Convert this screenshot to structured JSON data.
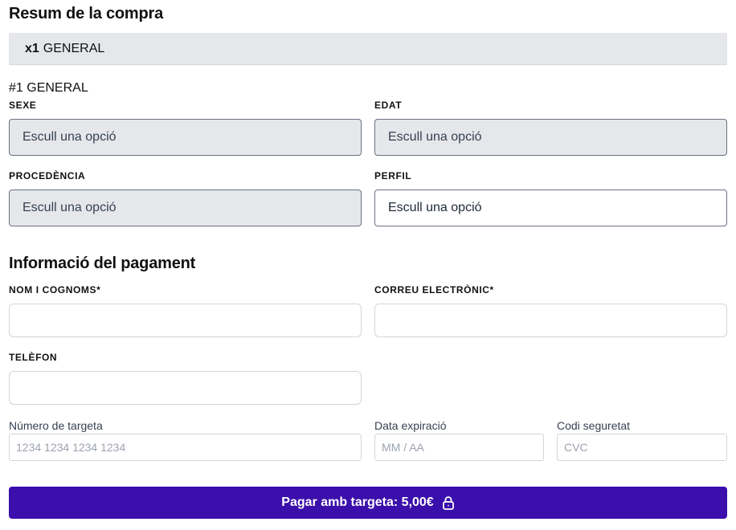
{
  "summary": {
    "title": "Resum de la compra",
    "item_qty": "x1",
    "item_name": "GENERAL"
  },
  "ticket": {
    "heading": "#1 GENERAL",
    "fields": {
      "sexe": {
        "label": "SEXE",
        "placeholder": "Escull una opció"
      },
      "edat": {
        "label": "EDAT",
        "placeholder": "Escull una opció"
      },
      "procedencia": {
        "label": "PROCEDÈNCIA",
        "placeholder": "Escull una opció"
      },
      "perfil": {
        "label": "PERFIL",
        "placeholder": "Escull una opció"
      }
    }
  },
  "payment": {
    "title": "Informació del pagament",
    "name_label": "NOM I COGNOMS*",
    "email_label": "CORREU ELECTRÒNIC*",
    "phone_label": "TELÈFON",
    "card_number_label": "Número de targeta",
    "card_number_placeholder": "1234 1234 1234 1234",
    "expiry_label": "Data expiració",
    "expiry_placeholder": "MM / AA",
    "cvc_label": "Codi seguretat",
    "cvc_placeholder": "CVC",
    "pay_button_label": "Pagar amb targeta: 5,00€",
    "pay_button_icon": "lock-icon"
  },
  "colors": {
    "accent": "#3b0fab",
    "select_bg": "#e5e7eb"
  }
}
